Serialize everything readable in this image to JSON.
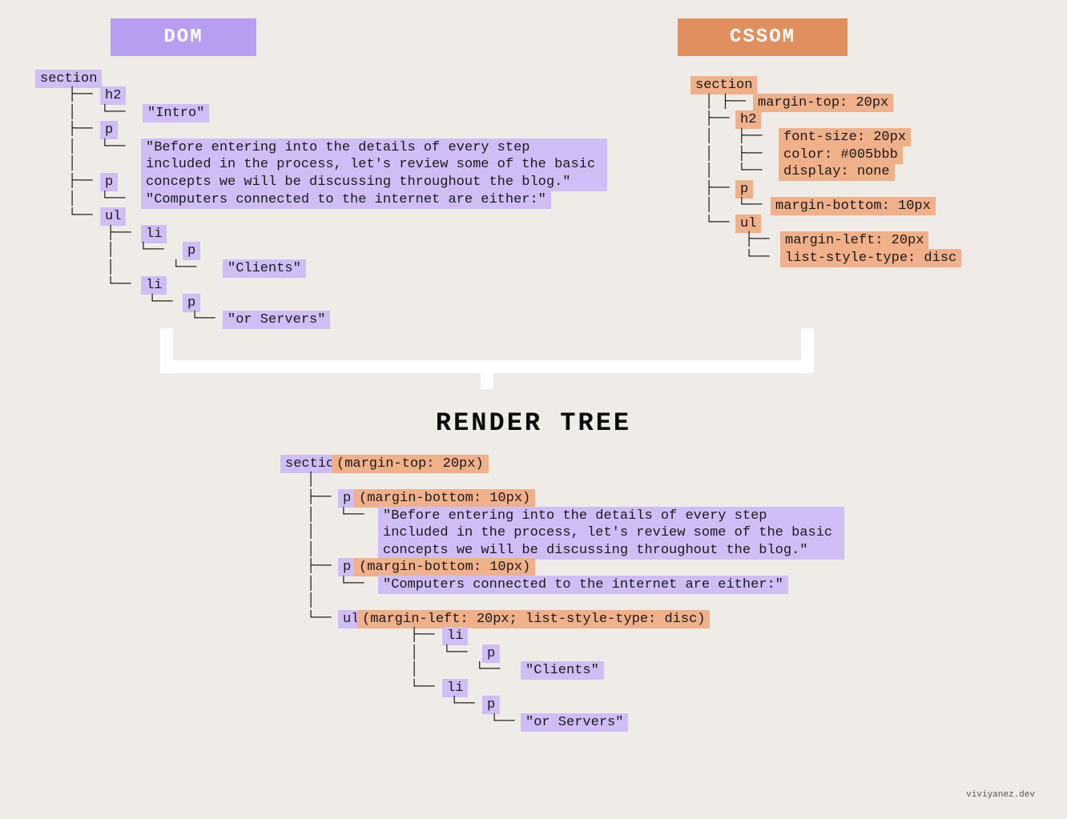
{
  "headers": {
    "dom": "DOM",
    "cssom": "CSSOM",
    "render": "RENDER  TREE"
  },
  "dom": {
    "section": "section",
    "h2": "h2",
    "intro": "\"Intro\"",
    "p1": "p",
    "p1_text": "\"Before entering into the details of every step included in the process, let's review some of the basic concepts we will be discussing throughout the blog.\"",
    "p2": "p",
    "p2_text": "\"Computers connected to the internet are either:\"",
    "ul": "ul",
    "li1": "li",
    "li1_p": "p",
    "li1_text": "\"Clients\"",
    "li2": "li",
    "li2_p": "p",
    "li2_text": "\"or Servers\""
  },
  "cssom": {
    "section": "section",
    "section_rule": "margin-top: 20px",
    "h2": "h2",
    "h2_r1": "font-size: 20px",
    "h2_r2": "color: #005bbb",
    "h2_r3": "display: none",
    "p": "p",
    "p_rule": "margin-bottom: 10px",
    "ul": "ul",
    "ul_r1": "margin-left: 20px",
    "ul_r2": "list-style-type: disc"
  },
  "render": {
    "section": "section",
    "section_rule": "(margin-top: 20px)",
    "p1": "p",
    "p1_rule": "(margin-bottom: 10px)",
    "p1_text": "\"Before entering into the details of every step included in the process, let's review some of the basic concepts we will be discussing throughout the blog.\"",
    "p2": "p",
    "p2_rule": "(margin-bottom: 10px)",
    "p2_text": "\"Computers connected to the internet are either:\"",
    "ul": "ul",
    "ul_rule": "(margin-left: 20px; list-style-type: disc)",
    "li1": "li",
    "li1_p": "p",
    "li1_text": "\"Clients\"",
    "li2": "li",
    "li2_p": "p",
    "li2_text": "\"or Servers\""
  },
  "watermark": "viviyanez.dev"
}
